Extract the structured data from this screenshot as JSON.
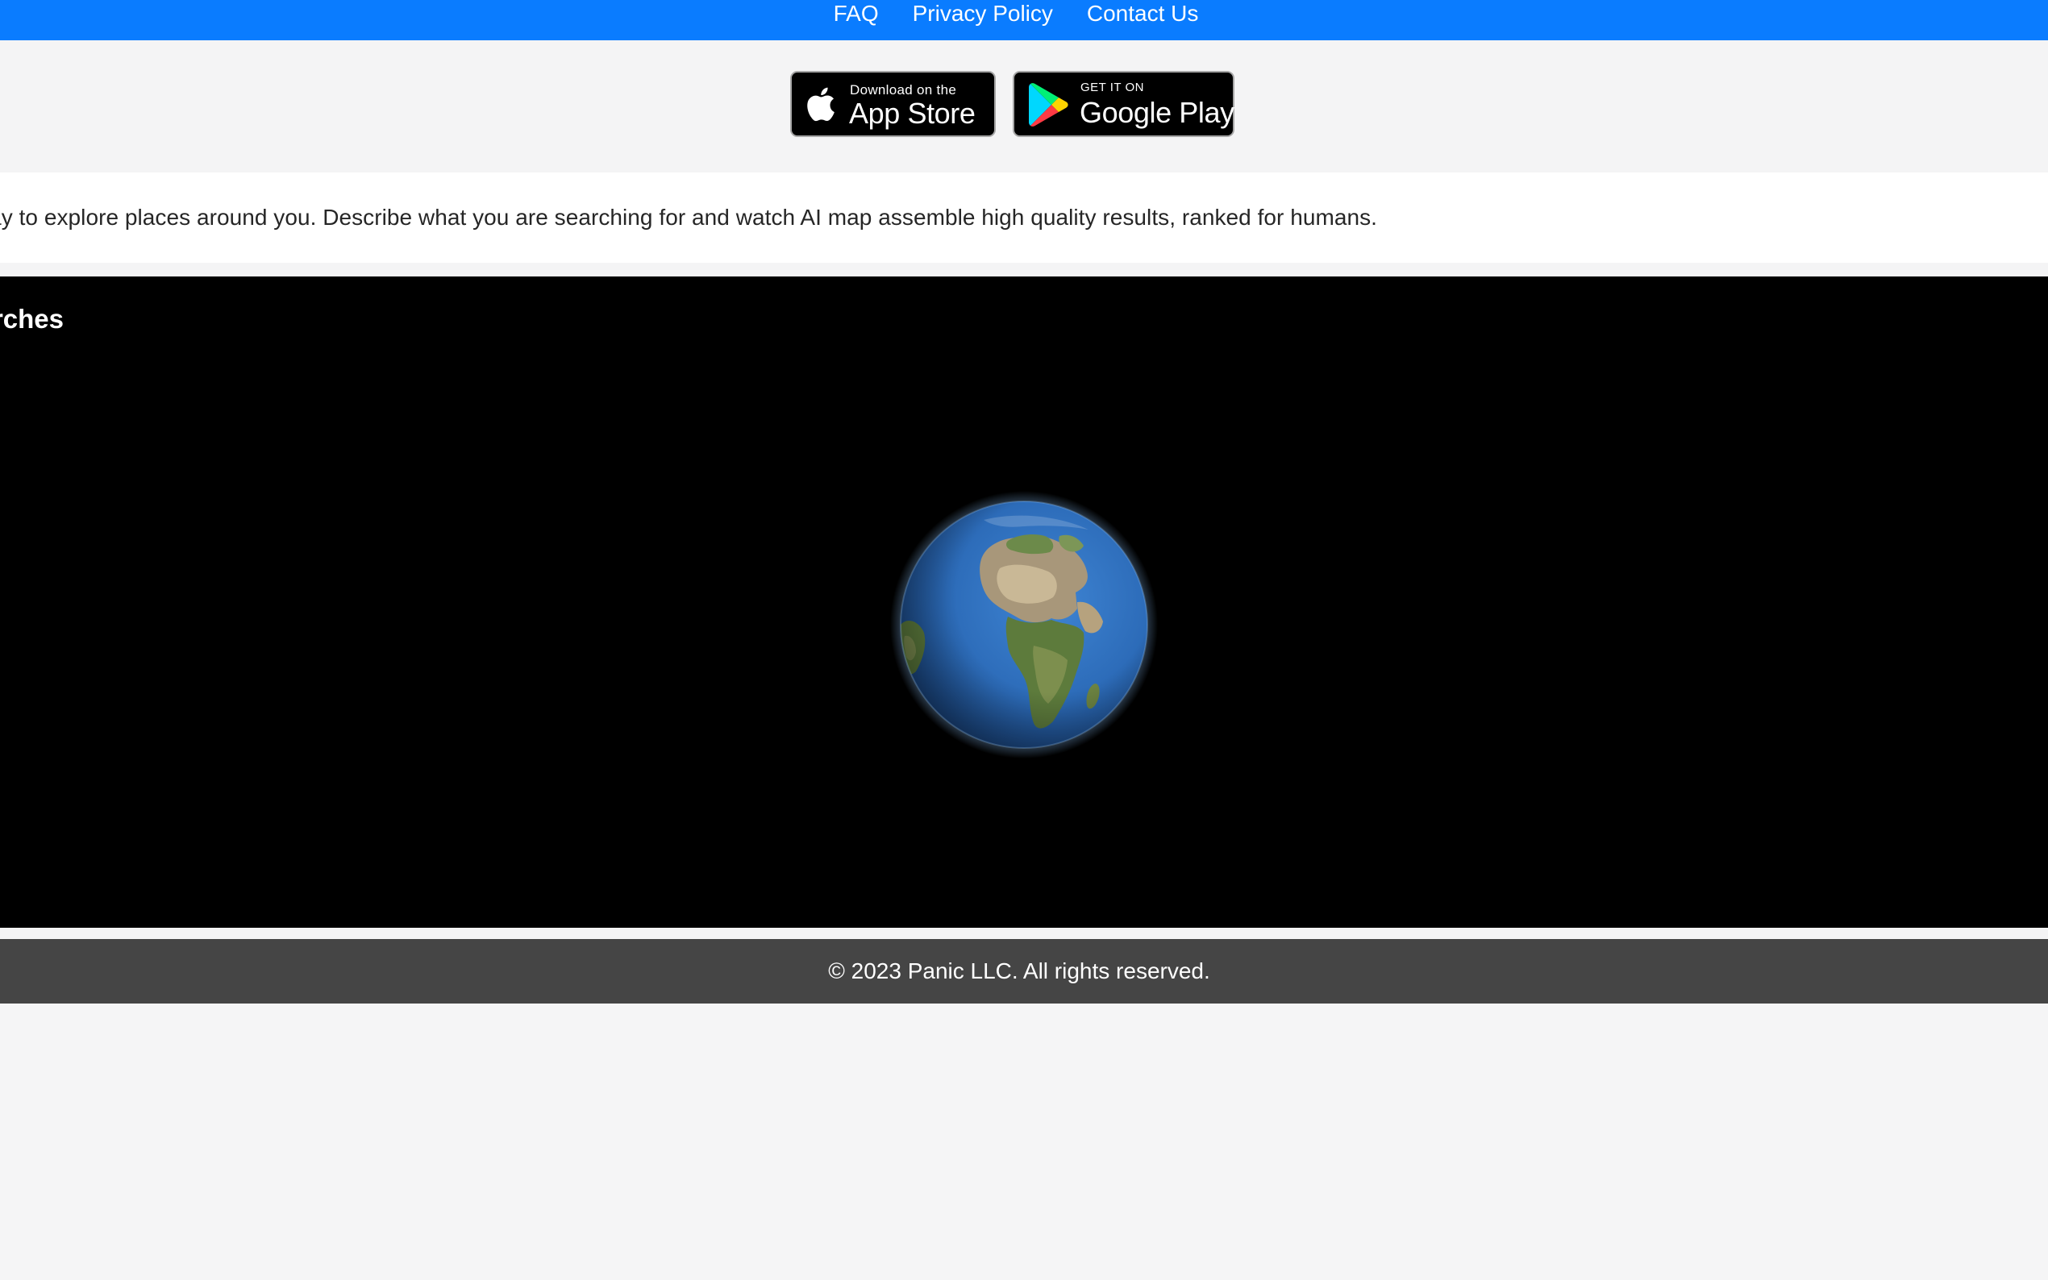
{
  "nav": {
    "links": [
      "FAQ",
      "Privacy Policy",
      "Contact Us"
    ],
    "background": "#0a7cff"
  },
  "badges": {
    "app_store": {
      "small": "Download on the",
      "big": "App Store",
      "icon": "apple-icon"
    },
    "google_play": {
      "small": "GET IT ON",
      "big": "Google Play",
      "icon": "google-play-icon"
    }
  },
  "intro": {
    "text": "ay to explore places around you. Describe what you are searching for and watch AI map assemble high quality results, ranked for humans."
  },
  "globe_section": {
    "heading": "rches",
    "globe_icon": "earth-globe",
    "background": "#000000"
  },
  "footer": {
    "copyright": "© 2023 Panic LLC. All rights reserved.",
    "background": "#454545"
  }
}
